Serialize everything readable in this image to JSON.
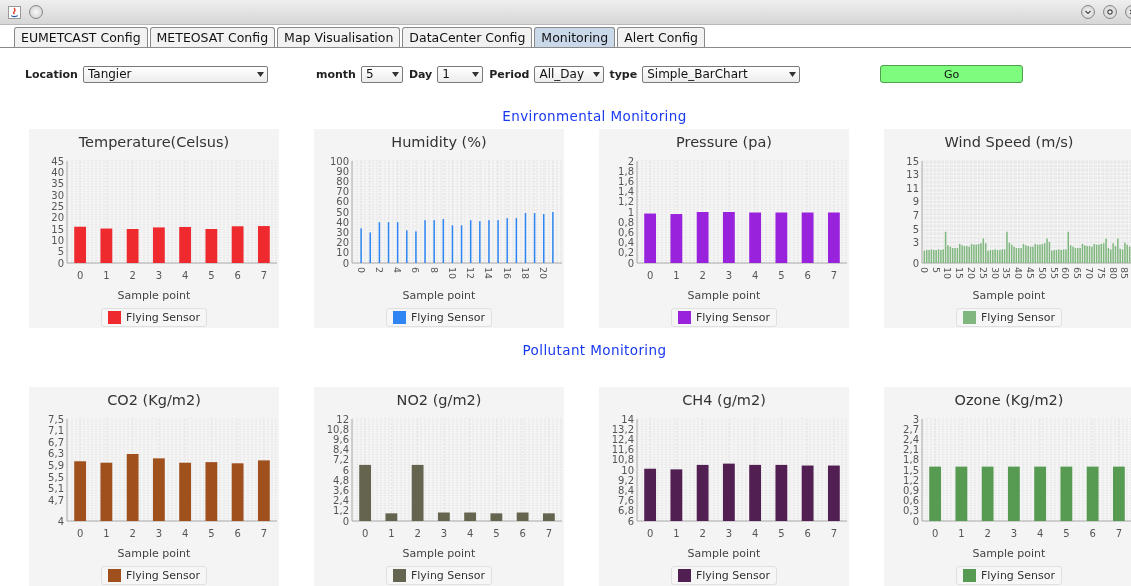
{
  "tabs": [
    {
      "label": "EUMETCAST Config",
      "selected": false
    },
    {
      "label": "METEOSAT Config",
      "selected": false
    },
    {
      "label": "Map Visualisation",
      "selected": false
    },
    {
      "label": "DataCenter Config",
      "selected": false
    },
    {
      "label": "Monitoring",
      "selected": true
    },
    {
      "label": "Alert Config",
      "selected": false
    }
  ],
  "filters": [
    {
      "label": "Location",
      "value": "Tangier"
    },
    {
      "label": "month",
      "value": "5"
    },
    {
      "label": "Day",
      "value": "1"
    },
    {
      "label": "Period",
      "value": "All_Day"
    },
    {
      "label": "type",
      "value": "Simple_BarChart"
    }
  ],
  "go_button": "Go",
  "sections": [
    {
      "heading": "Environmental Monitoring",
      "charts": [
        {
          "chart_data": {
            "type": "bar",
            "title": "Temperature(Celsus)",
            "xlabel": "Sample point",
            "grid": true,
            "categories": [
              "0",
              "1",
              "2",
              "3",
              "4",
              "5",
              "6",
              "7"
            ],
            "ylim": [
              0,
              45
            ],
            "yticks": [
              0,
              5,
              10,
              15,
              20,
              25,
              30,
              35,
              40,
              45
            ],
            "series": [
              {
                "name": "Flying Sensor",
                "color": "#ee2a2f",
                "values": [
                  16,
                  15.2,
                  15,
                  15.7,
                  15.9,
                  15,
                  16.2,
                  16.3
                ]
              }
            ]
          }
        },
        {
          "chart_data": {
            "type": "bar",
            "title": "Humidity (%)",
            "xlabel": "Sample point",
            "x": [
              0,
              1,
              2,
              3,
              4,
              5,
              6,
              7,
              8,
              9,
              10,
              11,
              12,
              13,
              14,
              15,
              16,
              17,
              18,
              19,
              20,
              21
            ],
            "xlim": [
              -1,
              22
            ],
            "xticks": [
              0,
              2,
              4,
              6,
              8,
              10,
              12,
              14,
              16,
              18,
              20
            ],
            "grid": true,
            "ylim": [
              0,
              100
            ],
            "yticks": [
              0,
              10,
              20,
              30,
              40,
              50,
              60,
              70,
              80,
              90,
              100
            ],
            "series": [
              {
                "name": "Flying Sensor",
                "color": "#2f86f2",
                "values": [
                  34,
                  30,
                  40,
                  40,
                  40,
                  32,
                  31,
                  42,
                  42,
                  43,
                  37,
                  37,
                  42,
                  41,
                  42,
                  42,
                  44,
                  44,
                  49,
                  49,
                  48,
                  50
                ]
              }
            ]
          }
        },
        {
          "chart_data": {
            "type": "bar",
            "title": "Pressure (pa)",
            "xlabel": "Sample point",
            "grid": true,
            "categories": [
              "0",
              "1",
              "2",
              "3",
              "4",
              "5",
              "6",
              "7"
            ],
            "ylim": [
              0,
              2
            ],
            "yticks": [
              0,
              {
                "value": 0.2,
                "label": "0,2"
              },
              {
                "value": 0.4,
                "label": "0,4"
              },
              {
                "value": 0.6,
                "label": "0,6"
              },
              {
                "value": 0.8,
                "label": "0,8"
              },
              1,
              {
                "value": 1.2,
                "label": "1,2"
              },
              {
                "value": 1.4,
                "label": "1,4"
              },
              {
                "value": 1.6,
                "label": "1,6"
              },
              {
                "value": 1.8,
                "label": "1,8"
              },
              2
            ],
            "series": [
              {
                "name": "Flying Sensor",
                "color": "#9922dd",
                "values": [
                  0.97,
                  0.96,
                  1.0,
                  1.0,
                  0.99,
                  0.99,
                  0.99,
                  0.99
                ]
              }
            ]
          }
        },
        {
          "chart_data": {
            "type": "bar",
            "title": "Wind Speed (m/s)",
            "xlabel": "Sample point",
            "x": [
              0,
              1,
              2,
              3,
              4,
              5,
              6,
              7,
              8,
              9,
              10,
              11,
              12,
              13,
              14,
              15,
              16,
              17,
              18,
              19,
              20,
              21,
              22,
              23,
              24,
              25,
              26,
              27,
              28,
              29,
              30,
              31,
              32,
              33,
              34,
              35,
              36,
              37,
              38,
              39,
              40,
              41,
              42,
              43,
              44,
              45,
              46,
              47,
              48,
              49,
              50,
              51,
              52,
              53,
              54,
              55,
              56,
              57,
              58,
              59,
              60,
              61,
              62,
              63,
              64,
              65,
              66,
              67,
              68,
              69,
              70,
              71,
              72,
              73,
              74,
              75,
              76,
              77,
              78,
              79,
              80,
              81,
              82,
              83,
              84,
              85,
              86,
              87
            ],
            "xlim": [
              -1,
              88
            ],
            "xticks": [
              0,
              5,
              10,
              15,
              20,
              25,
              30,
              35,
              40,
              45,
              50,
              55,
              60,
              65,
              70,
              75,
              80,
              85
            ],
            "grid": true,
            "ylim": [
              0,
              15
            ],
            "yticks": [
              0,
              3,
              5,
              7,
              9,
              11,
              13,
              15
            ],
            "series": [
              {
                "name": "Flying Sensor",
                "color": "#7fb77e",
                "values": [
                  1.8,
                  1.9,
                  1.9,
                  2.0,
                  1.9,
                  1.9,
                  2.0,
                  1.9,
                  2.0,
                  4.6,
                  2.6,
                  2.4,
                  2.2,
                  2.2,
                  2.2,
                  2.8,
                  2.6,
                  2.5,
                  2.5,
                  2.4,
                  2.8,
                  2.7,
                  2.7,
                  2.8,
                  2.9,
                  3.6,
                  2.9,
                  1.8,
                  1.9,
                  1.9,
                  2.0,
                  1.9,
                  1.9,
                  2.0,
                  2.0,
                  4.6,
                  3.0,
                  2.7,
                  2.4,
                  2.2,
                  2.2,
                  2.2,
                  2.8,
                  2.6,
                  2.5,
                  2.4,
                  2.4,
                  2.8,
                  2.7,
                  2.7,
                  2.8,
                  2.9,
                  3.6,
                  3.1,
                  1.8,
                  1.9,
                  1.9,
                  2.0,
                  1.9,
                  2.0,
                  2.0,
                  4.6,
                  2.6,
                  2.4,
                  2.2,
                  2.2,
                  2.2,
                  2.8,
                  2.6,
                  2.5,
                  2.5,
                  2.4,
                  2.8,
                  2.7,
                  2.7,
                  2.8,
                  2.9,
                  3.6,
                  2.2,
                  2.0,
                  2.9,
                  2.5,
                  3.6,
                  2.1,
                  2.0,
                  3.0,
                  2.7,
                  2.4
                ]
              }
            ]
          }
        }
      ]
    },
    {
      "heading": "Pollutant Monitoring",
      "charts": [
        {
          "chart_data": {
            "type": "bar",
            "title": "CO2 (Kg/m2)",
            "xlabel": "Sample point",
            "grid": true,
            "categories": [
              "0",
              "1",
              "2",
              "3",
              "4",
              "5",
              "6",
              "7"
            ],
            "ylim": [
              4,
              7.5
            ],
            "yticks": [
              4,
              {
                "value": 4.7,
                "label": "4,7"
              },
              {
                "value": 5.1,
                "label": "5,1"
              },
              {
                "value": 5.5,
                "label": "5,5"
              },
              {
                "value": 5.9,
                "label": "5,9"
              },
              {
                "value": 6.3,
                "label": "6,3"
              },
              {
                "value": 6.7,
                "label": "6,7"
              },
              {
                "value": 7.1,
                "label": "7,1"
              },
              {
                "value": 7.5,
                "label": "7,5"
              }
            ],
            "series": [
              {
                "name": "Flying Sensor",
                "color": "#a0501c",
                "values": [
                  6.05,
                  6.0,
                  6.3,
                  6.15,
                  6.0,
                  6.02,
                  5.98,
                  6.08
                ]
              }
            ]
          }
        },
        {
          "chart_data": {
            "type": "bar",
            "title": "NO2 (g/m2)",
            "xlabel": "Sample point",
            "grid": true,
            "categories": [
              "0",
              "1",
              "2",
              "3",
              "4",
              "5",
              "6",
              "7"
            ],
            "ylim": [
              0,
              12
            ],
            "yticks": [
              0,
              {
                "value": 1.2,
                "label": "1,2"
              },
              {
                "value": 2.4,
                "label": "2,4"
              },
              {
                "value": 3.6,
                "label": "3,6"
              },
              {
                "value": 4.8,
                "label": "4,8"
              },
              6,
              {
                "value": 7.2,
                "label": "7,2"
              },
              {
                "value": 8.4,
                "label": "8,4"
              },
              {
                "value": 9.6,
                "label": "9,6"
              },
              {
                "value": 10.8,
                "label": "10,8"
              },
              12
            ],
            "series": [
              {
                "name": "Flying Sensor",
                "color": "#65654f",
                "values": [
                  6.6,
                  0.9,
                  6.6,
                  1.0,
                  1.0,
                  0.9,
                  1.0,
                  0.9
                ]
              }
            ]
          }
        },
        {
          "chart_data": {
            "type": "bar",
            "title": "CH4 (g/m2)",
            "xlabel": "Sample point",
            "grid": true,
            "categories": [
              "0",
              "1",
              "2",
              "3",
              "4",
              "5",
              "6",
              "7"
            ],
            "ylim": [
              6,
              14
            ],
            "yticks": [
              6,
              {
                "value": 6.8,
                "label": "6,8"
              },
              {
                "value": 7.6,
                "label": "7,6"
              },
              {
                "value": 8.4,
                "label": "8,4"
              },
              {
                "value": 9.2,
                "label": "9,2"
              },
              10,
              {
                "value": 10.8,
                "label": "10,8"
              },
              {
                "value": 11.6,
                "label": "11,6"
              },
              {
                "value": 12.4,
                "label": "12,4"
              },
              {
                "value": 13.2,
                "label": "13,2"
              },
              14
            ],
            "series": [
              {
                "name": "Flying Sensor",
                "color": "#521f52",
                "values": [
                  10.1,
                  10.05,
                  10.4,
                  10.5,
                  10.4,
                  10.4,
                  10.35,
                  10.35
                ]
              }
            ]
          }
        },
        {
          "chart_data": {
            "type": "bar",
            "title": "Ozone (Kg/m2)",
            "xlabel": "Sample point",
            "grid": true,
            "categories": [
              "0",
              "1",
              "2",
              "3",
              "4",
              "5",
              "6",
              "7"
            ],
            "ylim": [
              0,
              3
            ],
            "yticks": [
              0,
              {
                "value": 0.3,
                "label": "0,3"
              },
              {
                "value": 0.6,
                "label": "0,6"
              },
              {
                "value": 0.9,
                "label": "0,9"
              },
              {
                "value": 1.2,
                "label": "1,2"
              },
              {
                "value": 1.5,
                "label": "1,5"
              },
              {
                "value": 1.8,
                "label": "1,8"
              },
              {
                "value": 2.1,
                "label": "2,1"
              },
              {
                "value": 2.4,
                "label": "2,4"
              },
              {
                "value": 2.7,
                "label": "2,7"
              },
              3
            ],
            "series": [
              {
                "name": "Flying Sensor",
                "color": "#579a52",
                "values": [
                  1.6,
                  1.6,
                  1.6,
                  1.6,
                  1.6,
                  1.6,
                  1.6,
                  1.6
                ]
              }
            ]
          }
        }
      ]
    }
  ]
}
